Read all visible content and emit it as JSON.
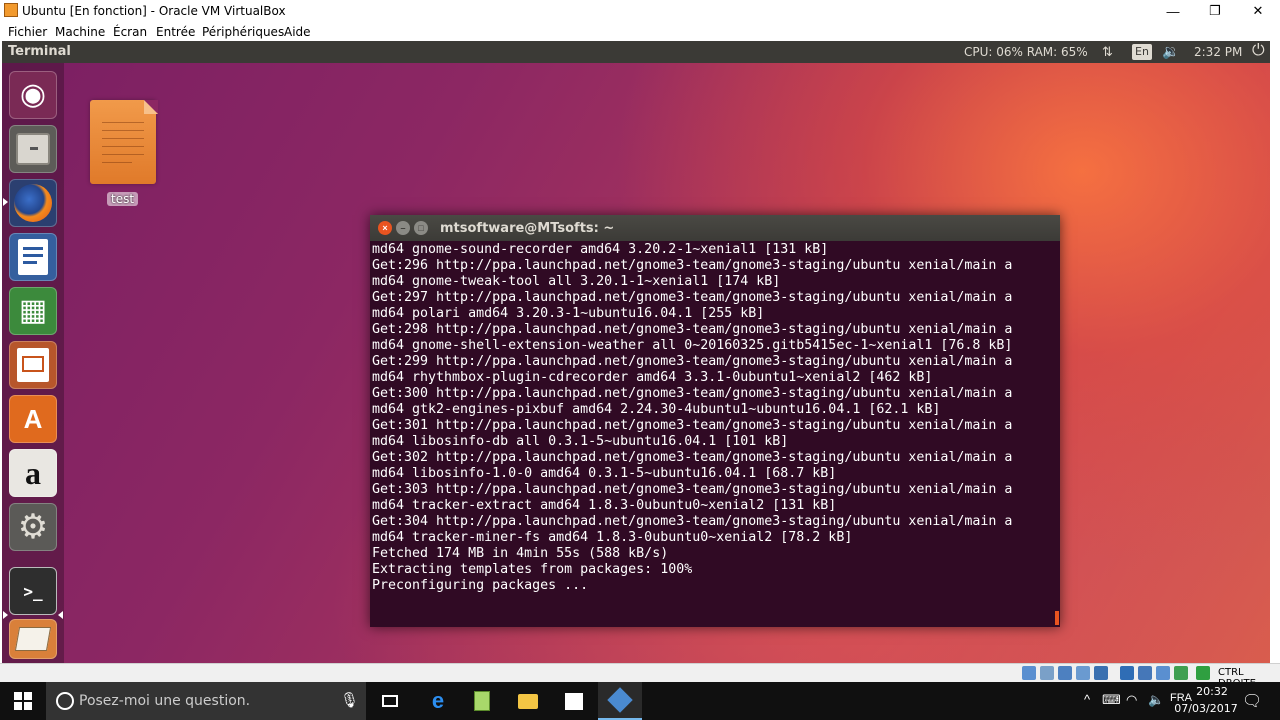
{
  "host_window": {
    "title": "Ubuntu [En fonction] - Oracle VM VirtualBox",
    "minimize_glyph": "—",
    "restore_glyph": "❐",
    "close_glyph": "✕"
  },
  "host_menu": [
    "Fichier",
    "Machine",
    "Écran",
    "Entrée",
    "Périphériques",
    "Aide"
  ],
  "guest_topbar": {
    "app_title": "Terminal",
    "cpu_ram": "CPU: 06% RAM: 65%",
    "keyboard_lang": "En",
    "clock": "2:32 PM"
  },
  "launcher": {
    "items": [
      {
        "name": "ubuntu-dash",
        "icon": "ubuntu-logo-icon"
      },
      {
        "name": "files",
        "icon": "file-cabinet-icon"
      },
      {
        "name": "firefox",
        "icon": "firefox-icon"
      },
      {
        "name": "libreoffice-writer",
        "icon": "writer-document-icon"
      },
      {
        "name": "libreoffice-calc",
        "icon": "calc-spreadsheet-icon"
      },
      {
        "name": "libreoffice-impress",
        "icon": "impress-presentation-icon"
      },
      {
        "name": "ubuntu-software",
        "icon": "software-bag-icon"
      },
      {
        "name": "amazon",
        "icon": "amazon-icon"
      },
      {
        "name": "system-settings",
        "icon": "settings-tools-icon"
      },
      {
        "name": "terminal",
        "icon": "terminal-icon"
      },
      {
        "name": "text-editor",
        "icon": "text-editor-icon"
      }
    ],
    "ubuntu_glyph": "◉",
    "amazon_glyph": "a",
    "terminal_glyph": ">_",
    "calc_glyph": "▦",
    "settings_glyph": "⚙"
  },
  "desktop": {
    "file_label": "test"
  },
  "terminal": {
    "title": "mtsoftware@MTsofts: ~",
    "close_glyph": "×",
    "min_glyph": "–",
    "max_glyph": "□",
    "lines": [
      "md64 gnome-sound-recorder amd64 3.20.2-1~xenial1 [131 kB]",
      "Get:296 http://ppa.launchpad.net/gnome3-team/gnome3-staging/ubuntu xenial/main a",
      "md64 gnome-tweak-tool all 3.20.1-1~xenial1 [174 kB]",
      "Get:297 http://ppa.launchpad.net/gnome3-team/gnome3-staging/ubuntu xenial/main a",
      "md64 polari amd64 3.20.3-1~ubuntu16.04.1 [255 kB]",
      "Get:298 http://ppa.launchpad.net/gnome3-team/gnome3-staging/ubuntu xenial/main a",
      "md64 gnome-shell-extension-weather all 0~20160325.gitb5415ec-1~xenial1 [76.8 kB]",
      "Get:299 http://ppa.launchpad.net/gnome3-team/gnome3-staging/ubuntu xenial/main a",
      "md64 rhythmbox-plugin-cdrecorder amd64 3.3.1-0ubuntu1~xenial2 [462 kB]",
      "Get:300 http://ppa.launchpad.net/gnome3-team/gnome3-staging/ubuntu xenial/main a",
      "md64 gtk2-engines-pixbuf amd64 2.24.30-4ubuntu1~ubuntu16.04.1 [62.1 kB]",
      "Get:301 http://ppa.launchpad.net/gnome3-team/gnome3-staging/ubuntu xenial/main a",
      "md64 libosinfo-db all 0.3.1-5~ubuntu16.04.1 [101 kB]",
      "Get:302 http://ppa.launchpad.net/gnome3-team/gnome3-staging/ubuntu xenial/main a",
      "md64 libosinfo-1.0-0 amd64 0.3.1-5~ubuntu16.04.1 [68.7 kB]",
      "Get:303 http://ppa.launchpad.net/gnome3-team/gnome3-staging/ubuntu xenial/main a",
      "md64 tracker-extract amd64 1.8.3-0ubuntu0~xenial2 [131 kB]",
      "Get:304 http://ppa.launchpad.net/gnome3-team/gnome3-staging/ubuntu xenial/main a",
      "md64 tracker-miner-fs amd64 1.8.3-0ubuntu0~xenial2 [78.2 kB]",
      "Fetched 174 MB in 4min 55s (588 kB/s)",
      "Extracting templates from packages: 100%",
      "Preconfiguring packages ..."
    ]
  },
  "vbox_status": {
    "host_key": "CTRL DROITE"
  },
  "taskbar": {
    "search_placeholder": "Posez-moi une question.",
    "time": "20:32",
    "date": "07/03/2017"
  },
  "colors": {
    "terminal_bg": "#300a24",
    "ubuntu_orange": "#e95420",
    "wm_bar": "#3b3a36",
    "taskbar": "#101010"
  }
}
